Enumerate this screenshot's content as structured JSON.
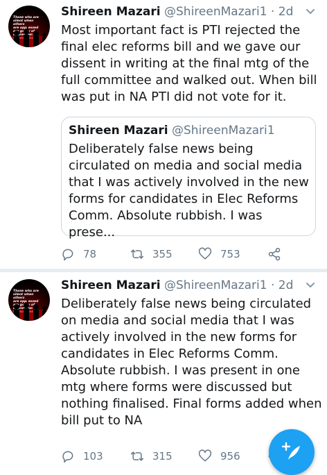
{
  "tweets": [
    {
      "author_name": "Shireen Mazari",
      "handle": "@ShireenMazari1 · 2d",
      "avatar_text": "Those who are silent when others\nare oppressed are guilty of\noppression themselves.\"",
      "text": "Most important fact is PTI rejected the\nfinal elec reforms bill and we gave our\ndissent in writing at the final mtg of the\nfull committee and walked out. When bill\nwas put in NA PTI did not vote for it.",
      "quoted": {
        "author_name": "Shireen Mazari",
        "handle": "@ShireenMazari1",
        "text": "Deliberately false news being\ncirculated on media and social media\nthat I was actively involved in the new\nforms for candidates in Elec Reforms\nComm. Absolute rubbish. I was prese..."
      },
      "actions": {
        "replies": "78",
        "retweets": "355",
        "likes": "753"
      }
    },
    {
      "author_name": "Shireen Mazari",
      "handle": "@ShireenMazari1 · 2d",
      "avatar_text": "Those who are silent when others\nare oppressed are guilty of\noppression themselves.\"",
      "text": "Deliberately false news being circulated\non media and social media that I was\nactively involved in the new forms for\ncandidates in Elec Reforms Comm.\nAbsolute rubbish. I was present in one\nmtg where forms were discussed but\nnothing finalised. Final forms added when\nbill put to NA",
      "actions": {
        "replies": "103",
        "retweets": "315",
        "likes": "956"
      }
    }
  ],
  "icons": {
    "reply": "reply-icon",
    "retweet": "retweet-icon",
    "like": "heart-icon",
    "share": "share-icon",
    "menu": "chevron-down-icon",
    "compose": "compose-tweet-icon"
  },
  "colors": {
    "accent": "#1da1f2",
    "muted": "#657786",
    "text": "#14171a",
    "border": "#ccd6dd"
  }
}
